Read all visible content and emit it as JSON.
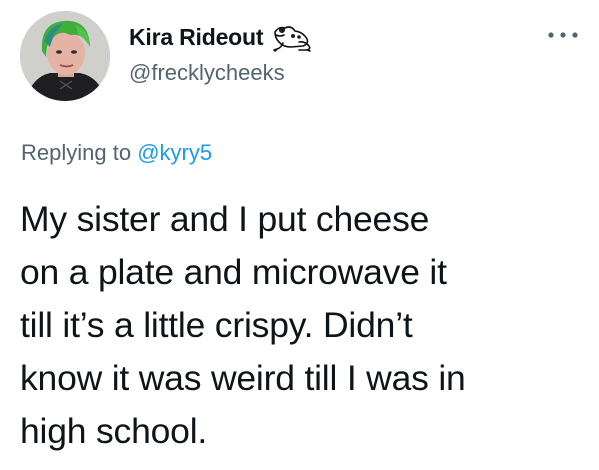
{
  "author": {
    "display_name": "Kira Rideout",
    "handle": "@frecklycheeks",
    "badge_icon": "frog-icon",
    "avatar_icon": "profile-photo"
  },
  "menu": {
    "icon": "more-options-icon"
  },
  "reply_context": {
    "prefix": "Replying to ",
    "handle": "@kyry5"
  },
  "tweet": {
    "lines": [
      "My sister and I put cheese",
      "on a plate and microwave it",
      "till it’s a little crispy. Didn’t",
      "know it was weird till I was in",
      "high school."
    ]
  },
  "colors": {
    "text": "#0f1419",
    "secondary": "#536471",
    "link": "#1d9bf0"
  }
}
